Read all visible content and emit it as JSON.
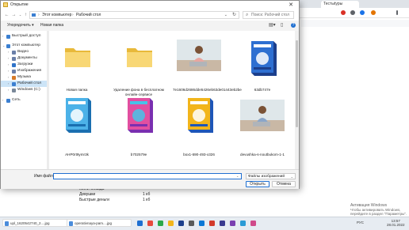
{
  "dialog": {
    "title": "Открытие",
    "breadcrumb": [
      "Этот компьютер",
      "Рабочий стол"
    ],
    "search_placeholder": "Поиск: Рабочий стол",
    "commands": {
      "organize": "Упорядочить",
      "new_folder": "Новая папка"
    },
    "nav_items": [
      {
        "label": "Быстрый доступ",
        "indent": 0,
        "icon": "star-icon",
        "color": "#3b7fd1"
      },
      {
        "label": "Этот компьютер",
        "indent": 0,
        "icon": "computer-icon",
        "color": "#3b7fd1"
      },
      {
        "label": "Видео",
        "indent": 1,
        "icon": "video-folder-icon",
        "color": "#6b7fa8"
      },
      {
        "label": "Документы",
        "indent": 1,
        "icon": "documents-folder-icon",
        "color": "#6b7fa8"
      },
      {
        "label": "Загрузки",
        "indent": 1,
        "icon": "downloads-folder-icon",
        "color": "#2f73c9"
      },
      {
        "label": "Изображения",
        "indent": 1,
        "icon": "pictures-folder-icon",
        "color": "#6b7fa8"
      },
      {
        "label": "Музыка",
        "indent": 1,
        "icon": "music-folder-icon",
        "color": "#d67a28"
      },
      {
        "label": "Рабочий стол",
        "indent": 1,
        "icon": "desktop-folder-icon",
        "color": "#3b7fd1",
        "selected": true
      },
      {
        "label": "Windows (C:)",
        "indent": 1,
        "icon": "drive-icon",
        "color": "#7a8899"
      },
      {
        "label": "Сеть",
        "indent": 0,
        "icon": "network-icon",
        "color": "#3b7fd1"
      }
    ],
    "files": [
      {
        "name": "Новая папка",
        "kind": "folder"
      },
      {
        "name": "Удаление фона в бесплатном онлайн-сервисе",
        "kind": "folder"
      },
      {
        "name": "7e1606d2686dde5426eb63de01443eb2be",
        "kind": "photo"
      },
      {
        "name": "63db747e",
        "kind": "box"
      },
      {
        "name": "AHP0rt9ymr3k",
        "kind": "box"
      },
      {
        "name": "b702579e",
        "kind": "box"
      },
      {
        "name": "box1-690-493-x326",
        "kind": "box"
      },
      {
        "name": "devushka-s-noutbukom-1-1",
        "kind": "photo"
      }
    ],
    "bottom": {
      "file_name_label": "Имя файла:",
      "file_name_value": "",
      "filter": "Файлы изображений",
      "open": "Открыть",
      "cancel": "Отмена"
    }
  },
  "browser": {
    "tab_label": "Тестыtypы",
    "list": [
      {
        "name": "Мили Спавда",
        "value": ""
      },
      {
        "name": "Девушки",
        "value": "1 кб"
      },
      {
        "name": "Быстрые деньги",
        "value": "1 кб"
      }
    ],
    "watermark_line1": "Активация Windows",
    "watermark_line2": "Чтобы активировать Windows, перейдите в раздел \"Параметры\"."
  },
  "taskbar": {
    "downloads": [
      "upl_1620542740_2....jpg",
      "operativnaya-pam....jpg"
    ],
    "lang": "РУС",
    "time": "13:57",
    "date": "28.01.2022",
    "colors": [
      "#1f6fd1",
      "#e8493d",
      "#2aa84a",
      "#f2b51b",
      "#1c3f8c",
      "#5a5a5a",
      "#0b78d6",
      "#d23a2b",
      "#3a3a8f",
      "#7a3fb0",
      "#2b9bd6",
      "#d04a8a"
    ]
  }
}
